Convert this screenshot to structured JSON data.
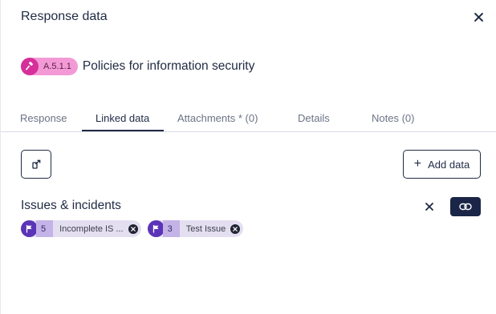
{
  "header": {
    "title": "Response data",
    "close_icon": "close-icon"
  },
  "control": {
    "badge_icon": "gavel-icon",
    "badge_code": "A.5.1.1",
    "badge_color": "#f39ad6",
    "badge_icon_color": "#d62f9a",
    "title": "Policies for information security"
  },
  "tabs": [
    {
      "label": "Response",
      "active": false
    },
    {
      "label": "Linked data",
      "active": true
    },
    {
      "label": "Attachments * (0)",
      "active": false
    },
    {
      "label": "Details",
      "active": false
    },
    {
      "label": "Notes (0)",
      "active": false
    }
  ],
  "toolbar": {
    "export_icon": "export-icon",
    "add_label": "Add data",
    "add_icon": "plus-icon"
  },
  "section": {
    "title": "Issues & incidents",
    "remove_icon": "close-icon",
    "link_icon": "link-icon",
    "link_button_color": "#1a2547"
  },
  "items": [
    {
      "icon": "issue-icon",
      "count": "5",
      "label": "Incomplete IS ...",
      "remove_icon": "remove-chip-icon"
    },
    {
      "icon": "issue-icon",
      "count": "3",
      "label": "Test Issue",
      "remove_icon": "remove-chip-icon"
    }
  ]
}
